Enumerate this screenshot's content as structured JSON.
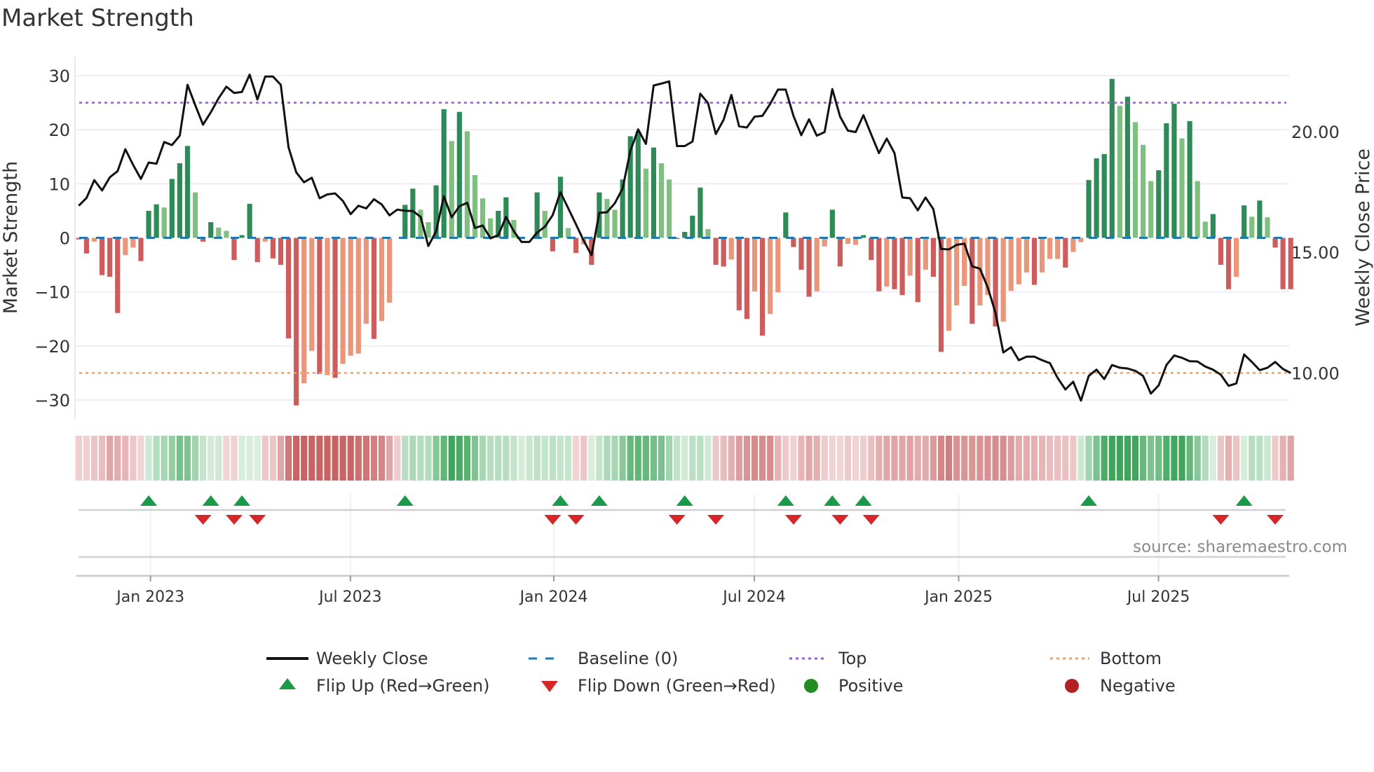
{
  "title": "Market Strength",
  "source": "source: sharemaestro.com",
  "legend": {
    "weekly_close": "Weekly Close",
    "baseline": "Baseline (0)",
    "top": "Top",
    "bottom": "Bottom",
    "flip_up": "Flip Up (Red→Green)",
    "flip_down": "Flip Down (Green→Red)",
    "positive": "Positive",
    "negative": "Negative"
  },
  "colors": {
    "G": "#2e8b57",
    "g": "#7fbf7f",
    "R": "#cd5c5c",
    "r": "#e9967a",
    "price": "#111111",
    "baseline": "#1f77b4",
    "top": "#9b59d6",
    "bottom": "#f0a060",
    "flip_up": "#1a9a48",
    "flip_down": "#d62728",
    "positive": "#228b22",
    "negative": "#b22222"
  },
  "chart_data": {
    "type": "bar",
    "title": "Market Strength",
    "ylabel": "Market Strength",
    "y2label": "Weekly Close Price",
    "ylim": [
      -33.5,
      33.5
    ],
    "y2lim": [
      8.1,
      23.1
    ],
    "xlim": [
      0.7,
      156.8
    ],
    "yticks": [
      -30,
      -20,
      -10,
      0,
      10,
      20,
      30
    ],
    "yticklabels": [
      "−30",
      "−20",
      "−10",
      "0",
      "10",
      "20",
      "30"
    ],
    "y2ticks": [
      10,
      15,
      20
    ],
    "y2ticklabels": [
      "10.00",
      "15.00",
      "20.00"
    ],
    "xticks": [
      {
        "label": "Jan 2023",
        "week": 10.24
      },
      {
        "label": "Jul 2023",
        "week": 35.97
      },
      {
        "label": "Jan 2024",
        "week": 62.15
      },
      {
        "label": "Jul 2024",
        "week": 87.96
      },
      {
        "label": "Jan 2025",
        "week": 114.26
      },
      {
        "label": "Jul 2025",
        "week": 139.98
      }
    ],
    "top_level": 25,
    "bottom_level": -25,
    "baseline": 0,
    "strength": [
      -0.3,
      -2.9,
      -0.7,
      -6.9,
      -7.2,
      -13.9,
      -3.2,
      -1.8,
      -4.3,
      5.0,
      6.2,
      5.6,
      10.9,
      13.8,
      17.0,
      8.4,
      -0.7,
      2.9,
      1.9,
      1.3,
      -4.1,
      0.5,
      6.3,
      -4.5,
      -0.7,
      -3.8,
      -5.0,
      -18.6,
      -31,
      -26.9,
      -20.9,
      -25.2,
      -25.4,
      -25.9,
      -23.3,
      -21.8,
      -21.4,
      -15.9,
      -18.7,
      -15.4,
      -12.0,
      0,
      6.1,
      9.1,
      5.2,
      2.9,
      9.7,
      23.8,
      17.9,
      23.3,
      19.7,
      11.6,
      7.3,
      3.6,
      5.0,
      7.5,
      3.3,
      0,
      0,
      8.4,
      5.0,
      -2.5,
      11.3,
      1.8,
      -2.8,
      -1.2,
      -5.0,
      8.4,
      7.2,
      5.2,
      10.8,
      18.8,
      19.7,
      12.8,
      16.7,
      13.8,
      10.8,
      -0.2,
      1.1,
      4.1,
      9.3,
      1.6,
      -5.0,
      -5.3,
      -4.0,
      -13.4,
      -15.0,
      -9.9,
      -18.1,
      -14.1,
      -10.1,
      4.7,
      -1.7,
      -5.9,
      -10.9,
      -9.9,
      -1.6,
      5.2,
      -5.3,
      -1.1,
      -1.3,
      0.5,
      -4.1,
      -9.9,
      -9.0,
      -9.5,
      -10.6,
      -7.0,
      -11.9,
      -5.9,
      -7.2,
      -21.1,
      -17.2,
      -12.5,
      -8.9,
      -15.9,
      -12.5,
      -10.6,
      -16.4,
      -15.5,
      -9.8,
      -8.6,
      -6.4,
      -8.7,
      -6.4,
      -3.9,
      -3.9,
      -5.5,
      -2.6,
      -0.8,
      10.7,
      14.7,
      15.5,
      29.4,
      24.4,
      26.1,
      21.4,
      17.2,
      10.5,
      12.5,
      21.2,
      24.8,
      18.4,
      21.6,
      10.5,
      3.0,
      4.4,
      -5.0,
      -9.5,
      -7.2,
      6.0,
      3.9,
      6.9,
      3.8,
      -1.8,
      -9.5,
      -9.5
    ],
    "strength_shade": "RRrRRRrrRGGgGGGgRGggRGGRrRRRRrrRrRrrrrRrrrGGggGGgGggggGGgggGgRGgRrRGggGGGgGggRGGGgRRrRRrRrrGRRRrrGRrrGRRrRRrRrRRrrrRrrRrrrrRrrrRrrGGGGgGgggGGGgGggGRRrGgGgRRR",
    "weekly_close": [
      16.93,
      17.25,
      17.99,
      17.56,
      18.11,
      18.36,
      19.27,
      18.62,
      18.04,
      18.72,
      18.67,
      19.57,
      19.44,
      19.83,
      21.94,
      21.09,
      20.29,
      20.8,
      21.38,
      21.86,
      21.6,
      21.64,
      22.36,
      21.33,
      22.28,
      22.28,
      21.94,
      19.35,
      18.31,
      17.9,
      18.09,
      17.24,
      17.4,
      17.44,
      17.13,
      16.58,
      16.93,
      16.82,
      17.2,
      16.98,
      16.53,
      16.77,
      16.72,
      16.71,
      16.47,
      15.26,
      15.87,
      17.32,
      16.45,
      16.91,
      17.05,
      16.01,
      16.11,
      15.58,
      15.71,
      16.47,
      15.87,
      15.43,
      15.43,
      15.82,
      16.06,
      16.54,
      17.49,
      16.83,
      16.16,
      15.48,
      14.88,
      16.64,
      16.66,
      17.03,
      17.64,
      19.2,
      20.09,
      19.49,
      21.91,
      21.99,
      22.08,
      19.4,
      19.4,
      19.59,
      21.57,
      21.18,
      19.9,
      20.49,
      21.52,
      20.22,
      20.17,
      20.62,
      20.65,
      21.15,
      21.74,
      21.74,
      20.65,
      19.85,
      20.51,
      19.83,
      19.98,
      21.76,
      20.62,
      20.04,
      19.98,
      20.68,
      19.88,
      19.11,
      19.71,
      19.11,
      17.27,
      17.24,
      16.74,
      17.27,
      16.79,
      15.14,
      15.12,
      15.31,
      15.36,
      14.42,
      14.32,
      13.55,
      12.49,
      10.85,
      11.07,
      10.53,
      10.68,
      10.68,
      10.53,
      10.41,
      9.8,
      9.32,
      9.64,
      8.86,
      9.88,
      10.14,
      9.75,
      10.33,
      10.22,
      10.19,
      10.09,
      9.88,
      9.15,
      9.49,
      10.33,
      10.73,
      10.63,
      10.49,
      10.48,
      10.27,
      10.14,
      9.93,
      9.47,
      9.57,
      10.77,
      10.46,
      10.12,
      10.22,
      10.46,
      10.17,
      10.0
    ],
    "flip_up_weeks": [
      10,
      18,
      22,
      43,
      63,
      68,
      79,
      92,
      98,
      102,
      131,
      151
    ],
    "flip_down_weeks": [
      17,
      21,
      24,
      62,
      65,
      78,
      83,
      93,
      99,
      103,
      148,
      155
    ],
    "grid": true,
    "legend_position": "bottom"
  }
}
